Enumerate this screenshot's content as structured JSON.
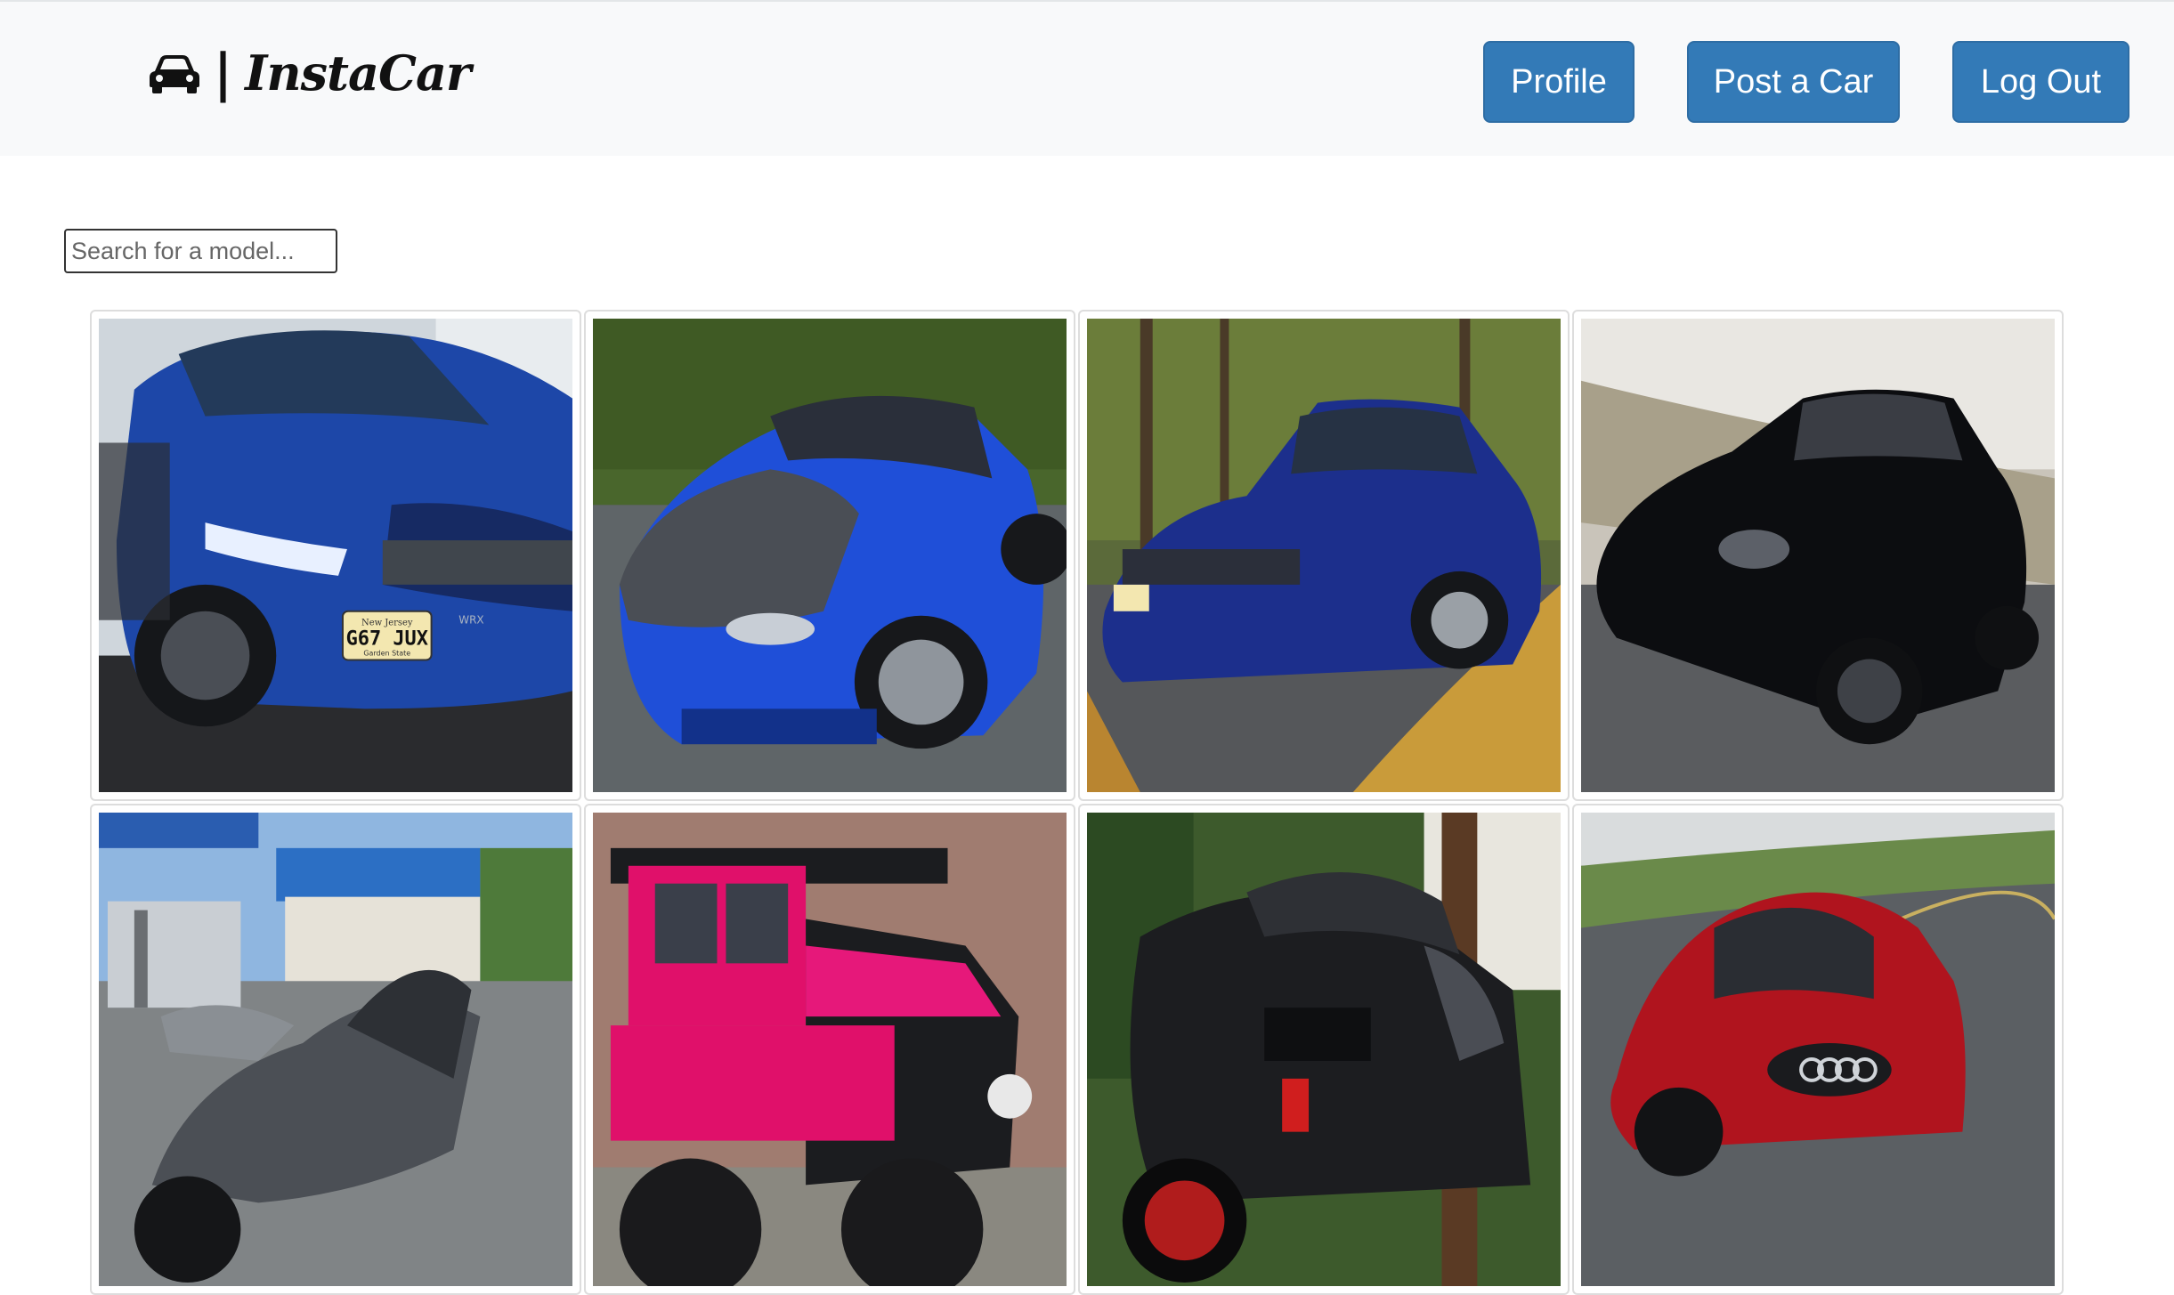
{
  "navbar": {
    "brand_separator": "|",
    "brand_name": "InstaCar",
    "brand_icon": "car-icon",
    "profile_label": "Profile",
    "post_label": "Post a Car",
    "logout_label": "Log Out",
    "button_color": "#337ab7"
  },
  "search": {
    "placeholder": "Search for a model..."
  },
  "gallery": {
    "items": [
      {
        "subject": "blue-sedan-photo",
        "plate": "G67 JUX",
        "plate_state": "New Jersey",
        "plate_motto": "Garden State",
        "badge": "WRX"
      },
      {
        "subject": "blue-sport-coupe-photo"
      },
      {
        "subject": "blue-sedan-autumn-photo"
      },
      {
        "subject": "black-sports-car-photo"
      },
      {
        "subject": "gray-motorcycle-photo"
      },
      {
        "subject": "pink-jeep-photo"
      },
      {
        "subject": "black-motorcycle-photo"
      },
      {
        "subject": "red-coupe-photo"
      }
    ]
  }
}
